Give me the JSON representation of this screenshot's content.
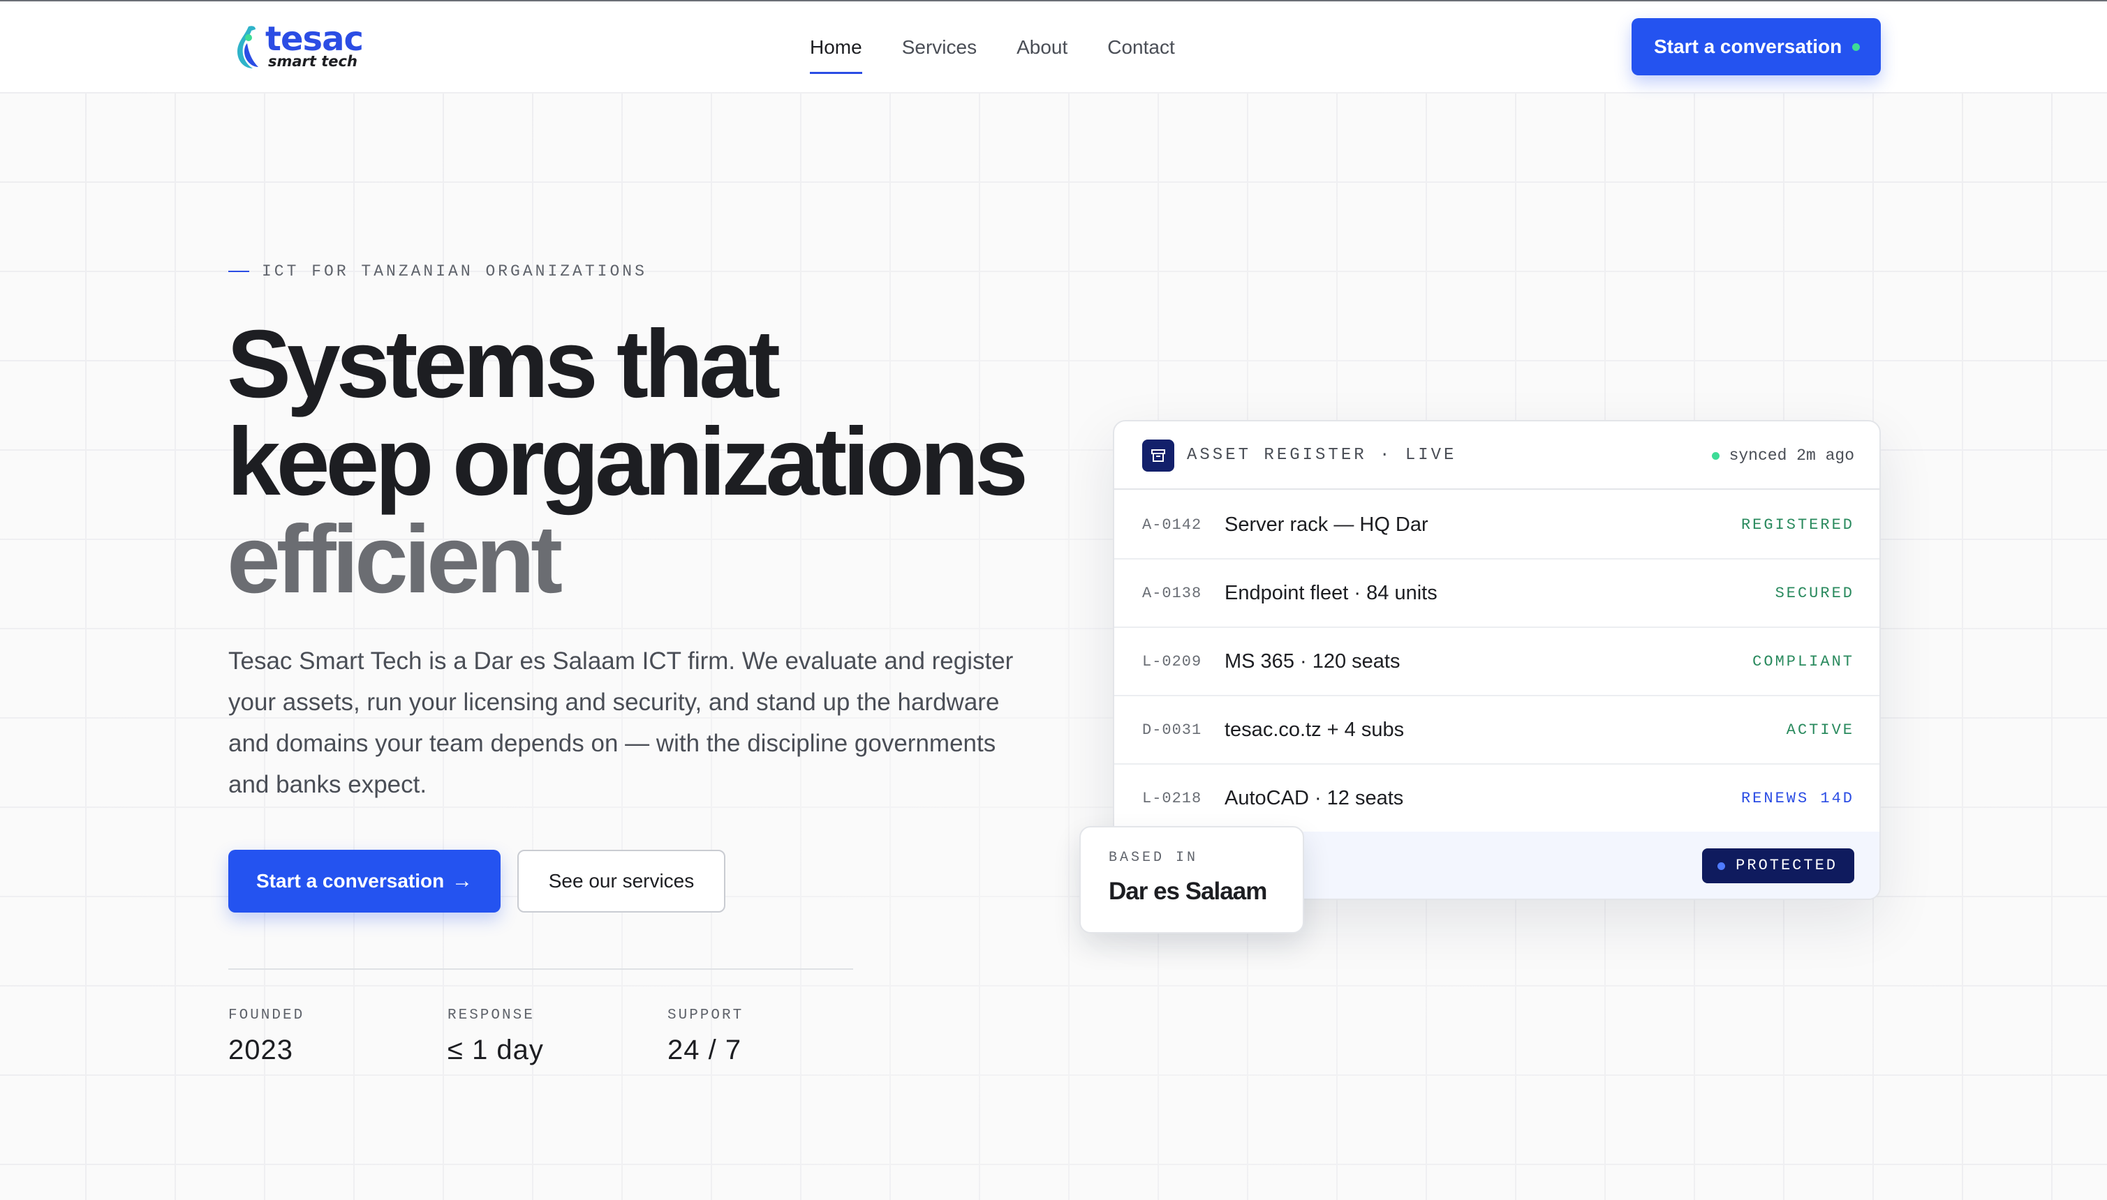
{
  "brand": {
    "name": "tesac",
    "tagline": "smart tech",
    "colors": {
      "primary": "#2453f0",
      "ink": "#1d1e22",
      "success": "#3ddc97",
      "navy": "#0f1b5e"
    }
  },
  "nav": {
    "items": [
      {
        "label": "Home",
        "active": true
      },
      {
        "label": "Services",
        "active": false
      },
      {
        "label": "About",
        "active": false
      },
      {
        "label": "Contact",
        "active": false
      }
    ],
    "cta_label": "Start a conversation"
  },
  "hero": {
    "eyebrow": "ICT FOR TANZANIAN ORGANIZATIONS",
    "headline_line1": "Systems that",
    "headline_line2": "keep organizations",
    "headline_line3": "efficient",
    "lead": "Tesac Smart Tech is a Dar es Salaam ICT firm. We evaluate and register your assets, run your licensing and security, and stand up the hardware and domains your team depends on — with the discipline governments and banks expect.",
    "primary_button": "Start a conversation",
    "primary_button_icon": "arrow-right-icon",
    "secondary_button": "See our services",
    "stats": [
      {
        "label": "FOUNDED",
        "value": "2023"
      },
      {
        "label": "RESPONSE",
        "value": "≤ 1 day"
      },
      {
        "label": "SUPPORT",
        "value": "24 / 7"
      }
    ]
  },
  "asset_card": {
    "title": "ASSET REGISTER · LIVE",
    "icon": "archive-box-icon",
    "sync_status": "synced 2m ago",
    "rows": [
      {
        "code": "A-0142",
        "name": "Server rack — HQ Dar",
        "status": "REGISTERED",
        "tone": "green"
      },
      {
        "code": "A-0138",
        "name": "Endpoint fleet · 84 units",
        "status": "SECURED",
        "tone": "green"
      },
      {
        "code": "L-0209",
        "name": "MS 365 · 120 seats",
        "status": "COMPLIANT",
        "tone": "green"
      },
      {
        "code": "D-0031",
        "name": "tesac.co.tz + 4 subs",
        "status": "ACTIVE",
        "tone": "green"
      },
      {
        "code": "L-0218",
        "name": "AutoCAD · 12 seats",
        "status": "RENEWS 14D",
        "tone": "blue"
      }
    ],
    "footer_badge": "PROTECTED"
  },
  "location_badge": {
    "label": "BASED IN",
    "value": "Dar es Salaam"
  }
}
